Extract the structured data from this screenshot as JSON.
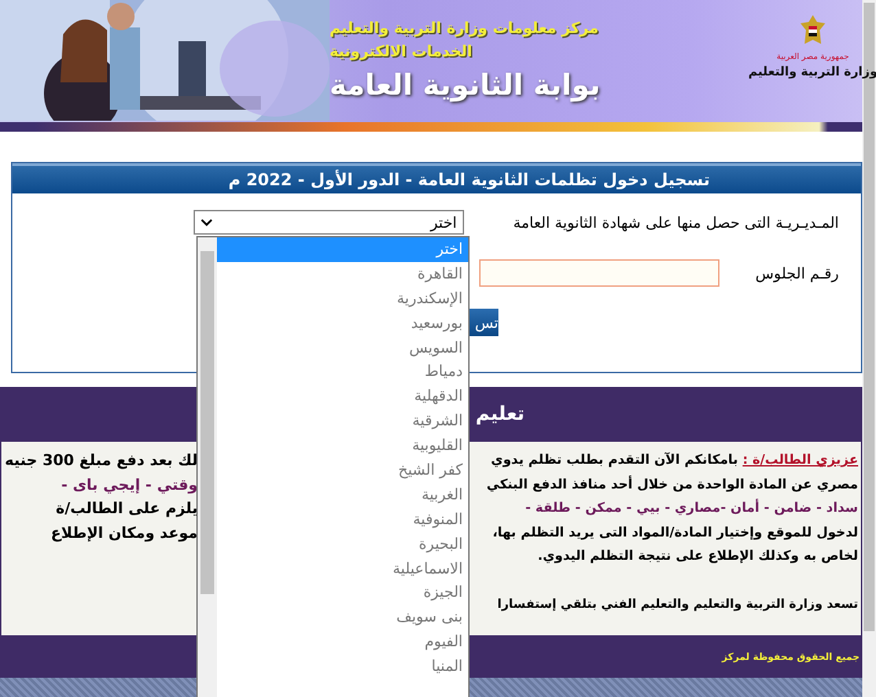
{
  "header": {
    "center_name": "مركز معلومات وزارة التربية والتعليم",
    "services": "الخدمات الالكترونية",
    "portal_title": "بوابة الثانوية العامة",
    "republic": "جمهورية مصر العربية",
    "ministry_logo": "وزارة التربية والتعليم"
  },
  "form": {
    "title": "تسجيل دخول تظلمات الثانوية العامة - الدور الأول - 2022 م",
    "directorate_label": "المـديـريـة التى حصل منها على شهادة الثانوية العامة",
    "directorate_value": "اختر",
    "seat_label": "رقـم الجلوس",
    "button": "تس"
  },
  "dropdown": {
    "options": [
      {
        "label": "اختر",
        "selected": true
      },
      {
        "label": "القاهرة",
        "selected": false
      },
      {
        "label": "الإسكندرية",
        "selected": false
      },
      {
        "label": "بورسعيد",
        "selected": false
      },
      {
        "label": "السويس",
        "selected": false
      },
      {
        "label": "دمياط",
        "selected": false
      },
      {
        "label": "الدقهلية",
        "selected": false
      },
      {
        "label": "الشرقية",
        "selected": false
      },
      {
        "label": "القليوبية",
        "selected": false
      },
      {
        "label": "كفر الشيخ",
        "selected": false
      },
      {
        "label": "الغربية",
        "selected": false
      },
      {
        "label": "المنوفية",
        "selected": false
      },
      {
        "label": "البحيرة",
        "selected": false
      },
      {
        "label": "الاسماعيلية",
        "selected": false
      },
      {
        "label": "الجيزة",
        "selected": false
      },
      {
        "label": "بنى سويف",
        "selected": false
      },
      {
        "label": "الفيوم",
        "selected": false
      },
      {
        "label": "المنيا",
        "selected": false
      }
    ]
  },
  "instructions": {
    "heading": "تعليم",
    "right_lines": [
      {
        "kind": "lead",
        "lead": "عزيزي الطالب/ة :",
        "text": "بامكانكم الآن التقدم بطلب تظلم يدوي"
      },
      {
        "kind": "plain",
        "text": "مصري عن المادة الواحدة من خلال أحد منافذ الدفع البنكي"
      },
      {
        "kind": "highlight",
        "text": "سداد - ضامن - أمان -مصاري - بيي - ممكن - طلقة -"
      },
      {
        "kind": "plain",
        "text": "لدخول للموقع وإختيار المادة/المواد التى يريد التظلم بها،"
      },
      {
        "kind": "plain",
        "text": "لخاص به وكذلك الإطلاع على نتيجة التظلم اليدوي."
      },
      {
        "kind": "gap",
        "text": "تسعد وزارة التربية والتعليم والتعليم الفني بتلقي إستفسارا"
      }
    ],
    "left_lines": [
      {
        "kind": "plain",
        "text": "لك بعد دفع مبلغ 300 جنيه"
      },
      {
        "kind": "highlight",
        "text": "وقتي - إيجي باى -"
      },
      {
        "kind": "plain",
        "text": "يلزم على الطالب/ة"
      },
      {
        "kind": "plain",
        "text": "موعد ومكان الإطلاع"
      }
    ]
  },
  "footer": {
    "text": "جميع الحقوق محفوظة لمركز"
  }
}
